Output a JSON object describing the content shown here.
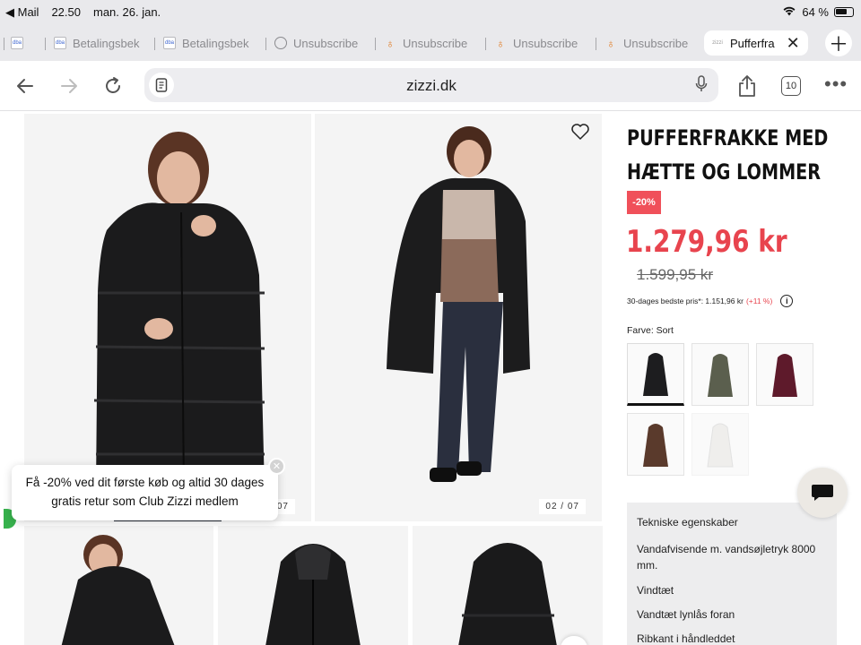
{
  "status_bar": {
    "back_app": "◀ Mail",
    "time": "22.50",
    "date": "man. 26. jan.",
    "battery": "64 %"
  },
  "tabs": [
    {
      "label": "",
      "favicon": "dba"
    },
    {
      "label": "Betalingsbek",
      "favicon": "dba"
    },
    {
      "label": "Betalingsbek",
      "favicon": "dba"
    },
    {
      "label": "Unsubscribe",
      "favicon": "globe"
    },
    {
      "label": "Unsubscribe",
      "favicon": "drop"
    },
    {
      "label": "Unsubscribe",
      "favicon": "drop"
    },
    {
      "label": "Unsubscribe",
      "favicon": "drop"
    },
    {
      "label": "Pufferfra",
      "favicon": "zizzi",
      "active": true
    }
  ],
  "toolbar": {
    "url": "zizzi.dk",
    "tab_count": "10"
  },
  "gallery": {
    "counter_1": "01 / 07",
    "counter_2": "02 / 07"
  },
  "product": {
    "title_line1": "PUFFERFRAKKE MED",
    "title_line2": "HÆTTE OG LOMMER",
    "discount": "-20%",
    "price": "1.279,96 kr",
    "old_price": "1.599,95 kr",
    "best_price_label": "30-dages bedste pris*: 1.151,96 kr",
    "best_price_delta": "(+11 %)",
    "color_label": "Farve: Sort",
    "swatches": [
      {
        "name": "black",
        "color": "#1d1d1f"
      },
      {
        "name": "olive",
        "color": "#5b5f4e"
      },
      {
        "name": "burgundy",
        "color": "#5e1a2b"
      },
      {
        "name": "brown",
        "color": "#5a3a2c"
      },
      {
        "name": "white",
        "color": "#f1f0ee"
      }
    ]
  },
  "specs": {
    "heading": "Tekniske egenskaber",
    "rows": [
      "Vandafvisende m. vandsøjletryk 8000 mm.",
      "Vindtæt",
      "Vandtæt lynlås foran",
      "Ribkant i håndleddet"
    ]
  },
  "promo": {
    "text_line1": "Få -20% ved dit første køb og altid 30 dages",
    "text_line2": "gratis retur som Club Zizzi medlem"
  }
}
